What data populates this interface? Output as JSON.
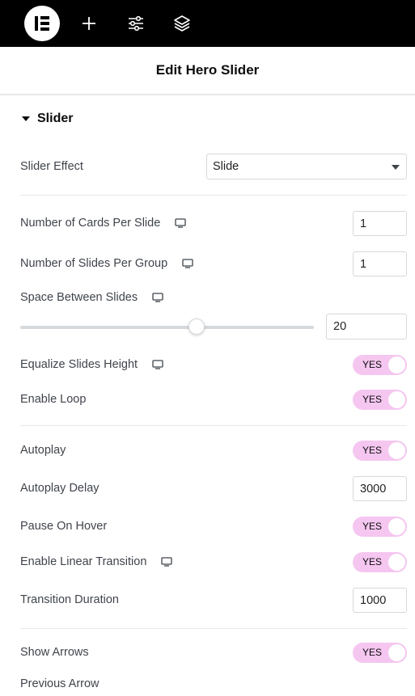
{
  "colors": {
    "topbar": "#000000",
    "toggle_on": "#f5c6f0",
    "text": "#3f444b",
    "border": "#d5d8dc"
  },
  "topbar": {
    "icons": [
      "elementor-logo-icon",
      "plus-icon",
      "sliders-icon",
      "layers-icon"
    ]
  },
  "header": {
    "title": "Edit Hero Slider"
  },
  "section": {
    "title": "Slider"
  },
  "fields": {
    "slider_effect": {
      "label": "Slider Effect",
      "value": "Slide"
    },
    "cards_per_slide": {
      "label": "Number of Cards Per Slide",
      "value": "1"
    },
    "slides_per_group": {
      "label": "Number of Slides Per Group",
      "value": "1"
    },
    "space_between": {
      "label": "Space Between Slides",
      "value": "20",
      "slider_fraction": 0.6
    },
    "equalize_height": {
      "label": "Equalize Slides Height",
      "state": "YES"
    },
    "enable_loop": {
      "label": "Enable Loop",
      "state": "YES"
    },
    "autoplay": {
      "label": "Autoplay",
      "state": "YES"
    },
    "autoplay_delay": {
      "label": "Autoplay Delay",
      "value": "3000"
    },
    "pause_on_hover": {
      "label": "Pause On Hover",
      "state": "YES"
    },
    "linear_transition": {
      "label": "Enable Linear Transition",
      "state": "YES"
    },
    "transition_duration": {
      "label": "Transition Duration",
      "value": "1000"
    },
    "show_arrows": {
      "label": "Show Arrows",
      "state": "YES"
    },
    "previous_arrow": {
      "label": "Previous Arrow"
    }
  }
}
